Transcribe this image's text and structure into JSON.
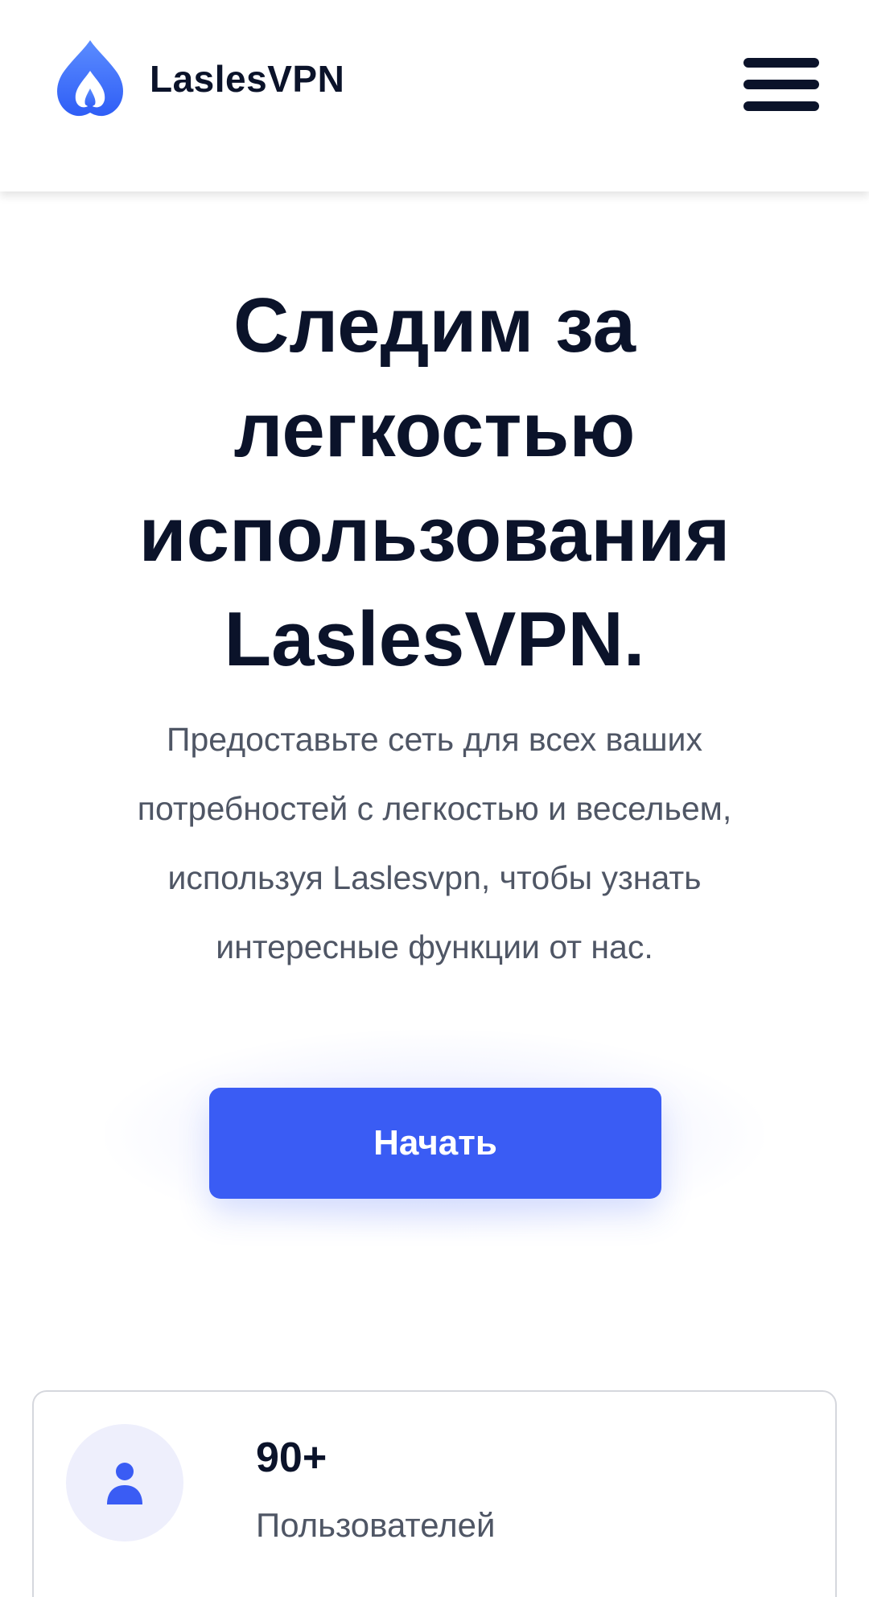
{
  "header": {
    "logo_text_part1": "Lasles",
    "logo_text_part2": "VPN",
    "menu_icon": "hamburger-menu-icon",
    "logo_icon": "flame-drop-logo-icon"
  },
  "hero": {
    "title_lines": [
      "Следим за",
      "легкостью",
      "использования",
      "LaslesVPN."
    ],
    "description_lines": [
      "Предоставьте сеть для всех ваших",
      "потребностей с легкостью и весельем,",
      "используя Laslesvpn, чтобы узнать",
      "интересные функции от нас."
    ],
    "cta_label": "Начать"
  },
  "stats": {
    "users": {
      "icon": "user-icon",
      "value": "90+",
      "label": "Пользователей"
    }
  },
  "colors": {
    "primary": "#3a5cf4",
    "logo_blue": "#4a74ff",
    "text_dark": "#0b132a",
    "text_gray": "#4f5665",
    "icon_bg": "#eeeffc"
  }
}
